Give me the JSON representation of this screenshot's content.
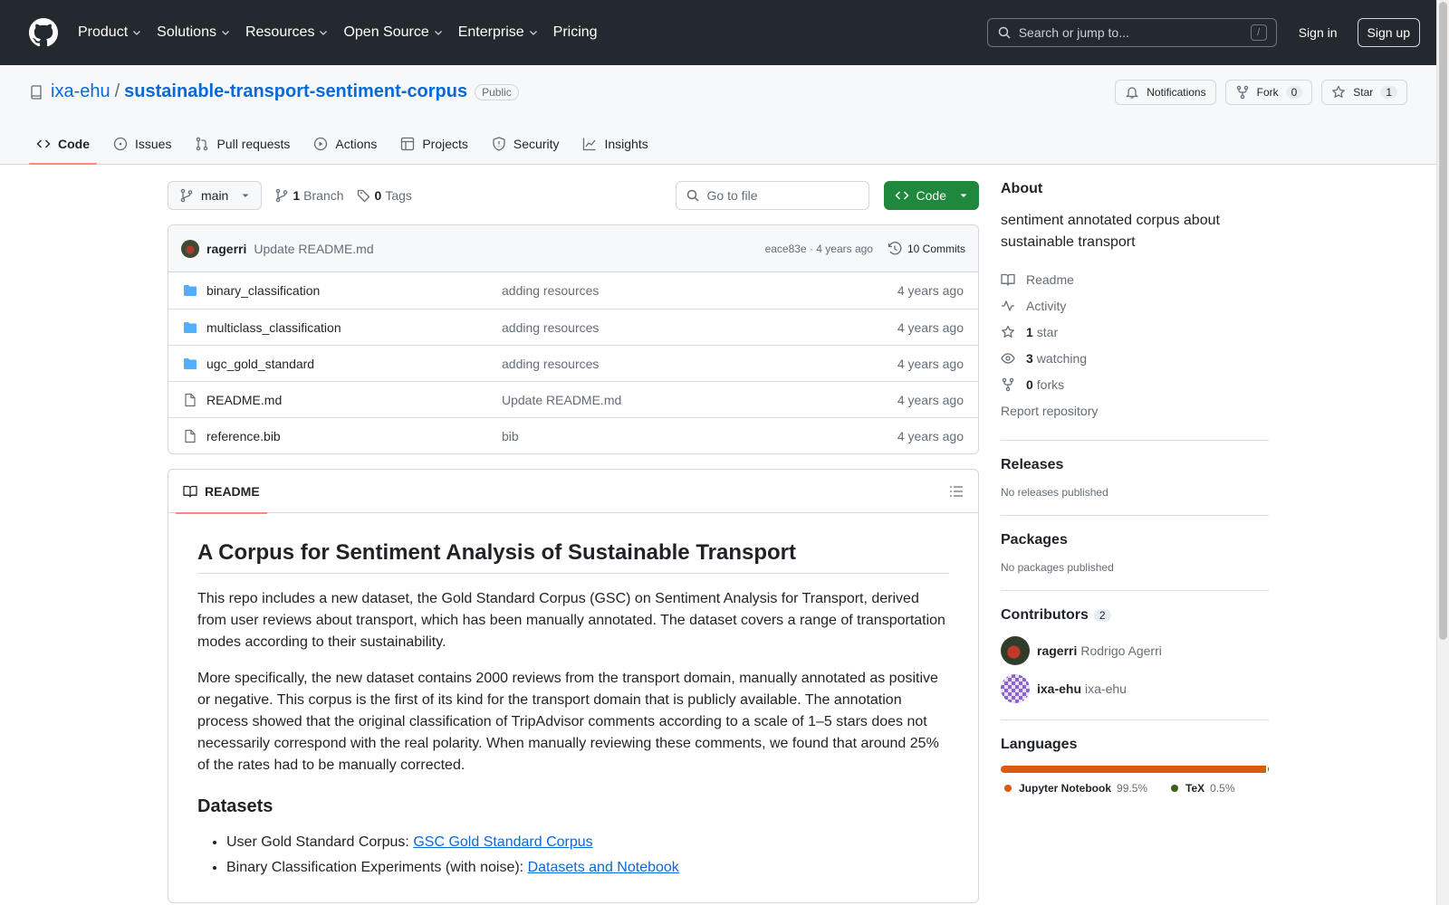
{
  "header": {
    "nav": [
      "Product",
      "Solutions",
      "Resources",
      "Open Source",
      "Enterprise",
      "Pricing"
    ],
    "search_placeholder": "Search or jump to...",
    "search_shortcut": "/",
    "signin": "Sign in",
    "signup": "Sign up"
  },
  "repo": {
    "owner": "ixa-ehu",
    "separator": "/",
    "name": "sustainable-transport-sentiment-corpus",
    "visibility": "Public",
    "notifications_label": "Notifications",
    "fork_label": "Fork",
    "fork_count": "0",
    "star_label": "Star",
    "star_count": "1",
    "tabs": [
      "Code",
      "Issues",
      "Pull requests",
      "Actions",
      "Projects",
      "Security",
      "Insights"
    ]
  },
  "toolbar": {
    "branch": "main",
    "branch_count": "1",
    "branch_label": "Branch",
    "tag_count": "0",
    "tag_label": "Tags",
    "goto_placeholder": "Go to file",
    "code_label": "Code"
  },
  "commit": {
    "author": "ragerri",
    "message": "Update README.md",
    "meta": "eace83e · 4 years ago",
    "commits": "10 Commits"
  },
  "files": [
    {
      "type": "dir",
      "name": "binary_classification",
      "message": "adding resources",
      "date": "4 years ago"
    },
    {
      "type": "dir",
      "name": "multiclass_classification",
      "message": "adding resources",
      "date": "4 years ago"
    },
    {
      "type": "dir",
      "name": "ugc_gold_standard",
      "message": "adding resources",
      "date": "4 years ago"
    },
    {
      "type": "file",
      "name": "README.md",
      "message": "Update README.md",
      "date": "4 years ago"
    },
    {
      "type": "file",
      "name": "reference.bib",
      "message": "bib",
      "date": "4 years ago"
    }
  ],
  "readme": {
    "tab": "README",
    "title": "A Corpus for Sentiment Analysis of Sustainable Transport",
    "p1": "This repo includes a new dataset, the Gold Standard Corpus (GSC) on Sentiment Analysis for Transport, derived from user reviews about transport, which has been manually annotated. The dataset covers a range of transportation modes according to their sustainability.",
    "p2": "More specifically, the new dataset contains 2000 reviews from the transport domain, manually annotated as positive or negative. This corpus is the first of its kind for the transport domain that is publicly available. The annotation process showed that the original classification of TripAdvisor comments according to a scale of 1–5 stars does not necessarily correspond with the real polarity. When manually reviewing these comments, we found that around 25% of the rates had to be manually corrected.",
    "h2": "Datasets",
    "items": [
      {
        "text": "User Gold Standard Corpus: ",
        "link": "GSC Gold Standard Corpus"
      },
      {
        "text": "Binary Classification Experiments (with noise): ",
        "link": "Datasets and Notebook"
      }
    ]
  },
  "about": {
    "title": "About",
    "description": "sentiment annotated corpus about sustainable transport",
    "readme": "Readme",
    "activity": "Activity",
    "stars_count": "1",
    "stars_label": "star",
    "watching_count": "3",
    "watching_label": "watching",
    "forks_count": "0",
    "forks_label": "forks",
    "report": "Report repository"
  },
  "releases": {
    "title": "Releases",
    "empty": "No releases published"
  },
  "packages": {
    "title": "Packages",
    "empty": "No packages published"
  },
  "contributors": {
    "title": "Contributors",
    "count": "2",
    "list": [
      {
        "login": "ragerri",
        "name": "Rodrigo Agerri"
      },
      {
        "login": "ixa-ehu",
        "name": "ixa-ehu"
      }
    ]
  },
  "languages": {
    "title": "Languages",
    "list": [
      {
        "name": "Jupyter Notebook",
        "pct": "99.5%",
        "value": 99.5,
        "color": "#DA5B0B"
      },
      {
        "name": "TeX",
        "pct": "0.5%",
        "value": 0.5,
        "color": "#3D6117"
      }
    ]
  }
}
